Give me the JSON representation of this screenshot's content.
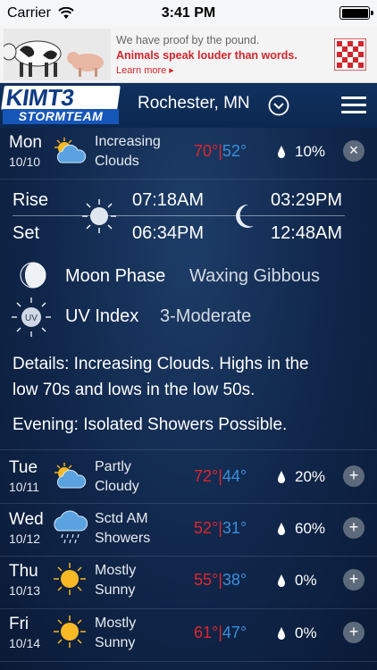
{
  "status_bar": {
    "carrier": "Carrier",
    "time": "3:41 PM"
  },
  "ad": {
    "line1": "We have proof by the pound.",
    "line2": "Animals speak louder than words.",
    "link": "Learn more ▸"
  },
  "header": {
    "logo_top": "KIMT3",
    "logo_bottom": "STORMTEAM",
    "location": "Rochester, MN"
  },
  "today": {
    "day": "Mon",
    "date": "10/10",
    "condition_line1": "Increasing",
    "condition_line2": "Clouds",
    "high": "70°",
    "sep": "|",
    "low": "52°",
    "precip": "10%",
    "icon": "partly-cloudy-icon",
    "close_label": "×"
  },
  "sun_moon": {
    "rise_label": "Rise",
    "set_label": "Set",
    "sunrise": "07:18AM",
    "sunset": "06:34PM",
    "moonrise": "03:29PM",
    "moonset": "12:48AM"
  },
  "moon_phase": {
    "label": "Moon Phase",
    "value": "Waxing Gibbous"
  },
  "uv": {
    "label": "UV Index",
    "value": "3-Moderate",
    "icon_text": "UV"
  },
  "details": {
    "line1": "Details: Increasing Clouds. Highs in the",
    "line2": "low 70s and lows in the low 50s.",
    "evening": "Evening: Isolated Showers Possible."
  },
  "forecast": [
    {
      "day": "Tue",
      "date": "10/11",
      "c1": "Partly",
      "c2": "Cloudy",
      "high": "72°",
      "sep": "|",
      "low": "44°",
      "precip": "20%",
      "icon": "partly-cloudy-icon",
      "btn": "+"
    },
    {
      "day": "Wed",
      "date": "10/12",
      "c1": "Sctd AM",
      "c2": "Showers",
      "high": "52°",
      "sep": "|",
      "low": "31°",
      "precip": "60%",
      "icon": "rain-cloud-icon",
      "btn": "+"
    },
    {
      "day": "Thu",
      "date": "10/13",
      "c1": "Mostly",
      "c2": "Sunny",
      "high": "55°",
      "sep": "|",
      "low": "38°",
      "precip": "0%",
      "icon": "sun-icon",
      "btn": "+"
    },
    {
      "day": "Fri",
      "date": "10/14",
      "c1": "Mostly",
      "c2": "Sunny",
      "high": "61°",
      "sep": "|",
      "low": "47°",
      "precip": "0%",
      "icon": "sun-icon",
      "btn": "+"
    }
  ],
  "colors": {
    "high": "#e0262b",
    "low": "#3b8fdc",
    "header": "#10315f"
  }
}
